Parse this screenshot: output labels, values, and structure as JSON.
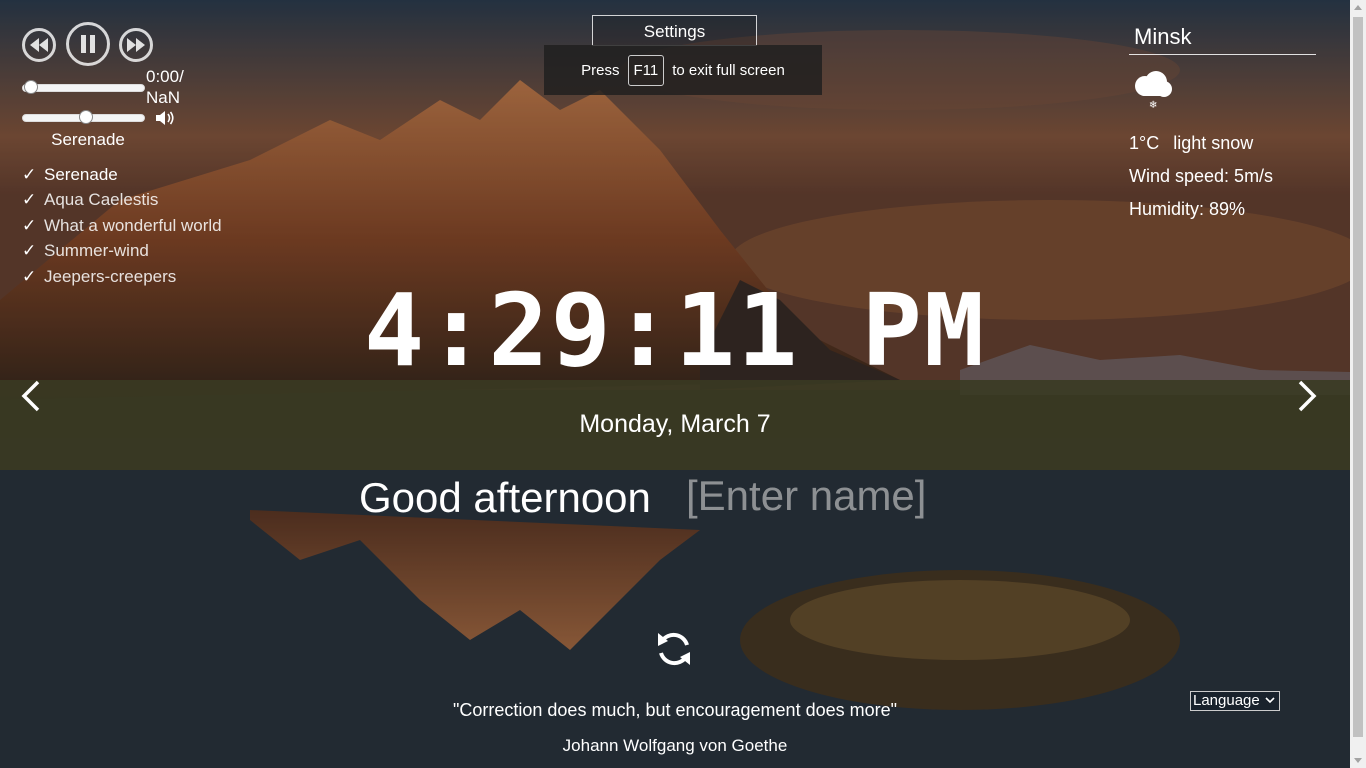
{
  "player": {
    "time_text": "0:00/",
    "duration_text": "NaN",
    "progress": 0,
    "volume": 0.5,
    "current_track": "Serenade",
    "playlist": [
      "Serenade",
      "Aqua Caelestis",
      "What a wonderful world",
      "Summer-wind",
      "Jeepers-creepers"
    ],
    "check_mark": "✓"
  },
  "settings": {
    "label": "Settings"
  },
  "fullscreen_notice": {
    "prefix": "Press",
    "key": "F11",
    "suffix": "to exit full screen"
  },
  "weather": {
    "city": "Minsk",
    "icon": "light-snow-icon",
    "temperature": "1°C",
    "description": "light snow",
    "wind": "Wind speed: 5m/s",
    "humidity": "Humidity: 89%"
  },
  "clock": {
    "time": "4:29:11 PM",
    "date": "Monday, March 7"
  },
  "greeting": {
    "text": "Good afternoon",
    "name_placeholder": "[Enter name]"
  },
  "quote": {
    "text": "\"Correction does much, but encouragement does more\"",
    "author": "Johann Wolfgang von Goethe"
  },
  "language": {
    "label": "Language"
  },
  "colors": {
    "text": "#ffffff",
    "scrollbar": "#f0f0f0"
  }
}
